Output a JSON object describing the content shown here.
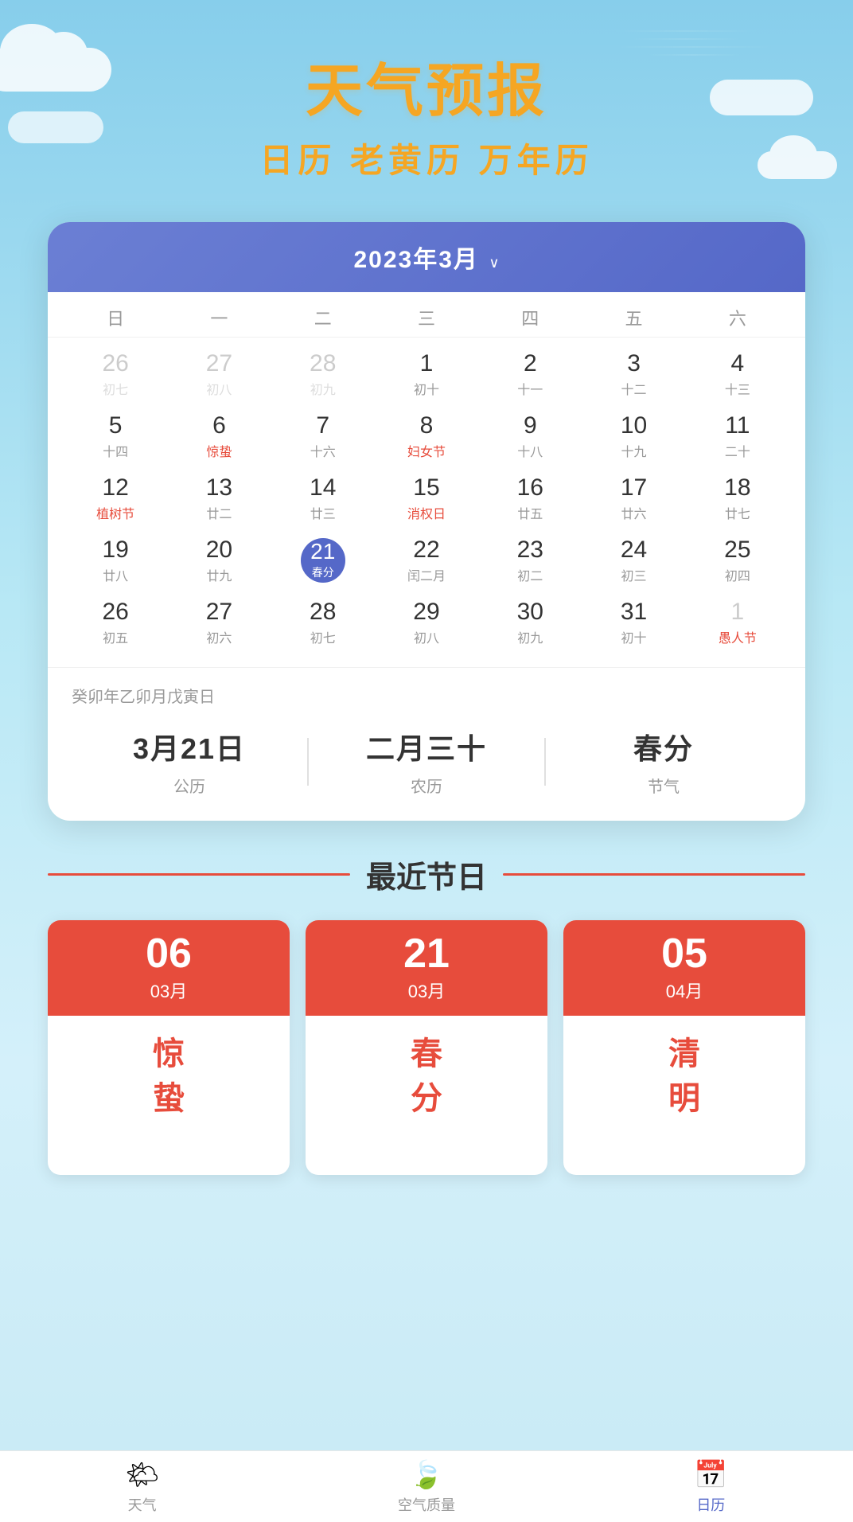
{
  "app": {
    "title": "天气预报",
    "subtitle": "日历 老黄历 万年历"
  },
  "calendar": {
    "month_title": "2023年3月",
    "chevron": "∨",
    "weekdays": [
      "日",
      "一",
      "二",
      "三",
      "四",
      "五",
      "六"
    ],
    "rows": [
      [
        {
          "date": "26",
          "lunar": "初七",
          "other": true
        },
        {
          "date": "27",
          "lunar": "初八",
          "other": true
        },
        {
          "date": "28",
          "lunar": "初九",
          "other": true
        },
        {
          "date": "1",
          "lunar": "初十"
        },
        {
          "date": "2",
          "lunar": "十一"
        },
        {
          "date": "3",
          "lunar": "十二"
        },
        {
          "date": "4",
          "lunar": "十三"
        }
      ],
      [
        {
          "date": "5",
          "lunar": "十四"
        },
        {
          "date": "6",
          "lunar": "惊蛰",
          "festival": true
        },
        {
          "date": "7",
          "lunar": "十六"
        },
        {
          "date": "8",
          "lunar": "妇女节",
          "festival": true
        },
        {
          "date": "9",
          "lunar": "十八"
        },
        {
          "date": "10",
          "lunar": "十九"
        },
        {
          "date": "11",
          "lunar": "二十"
        }
      ],
      [
        {
          "date": "12",
          "lunar": "植树节",
          "festival": true
        },
        {
          "date": "13",
          "lunar": "廿二"
        },
        {
          "date": "14",
          "lunar": "廿三"
        },
        {
          "date": "15",
          "lunar": "消权日",
          "festival": true
        },
        {
          "date": "16",
          "lunar": "廿五"
        },
        {
          "date": "17",
          "lunar": "廿六"
        },
        {
          "date": "18",
          "lunar": "廿七"
        }
      ],
      [
        {
          "date": "19",
          "lunar": "廿八"
        },
        {
          "date": "20",
          "lunar": "廿九"
        },
        {
          "date": "21",
          "lunar": "春分",
          "today": true,
          "festival": true
        },
        {
          "date": "22",
          "lunar": "闰二月"
        },
        {
          "date": "23",
          "lunar": "初二"
        },
        {
          "date": "24",
          "lunar": "初三"
        },
        {
          "date": "25",
          "lunar": "初四"
        }
      ],
      [
        {
          "date": "26",
          "lunar": "初五"
        },
        {
          "date": "27",
          "lunar": "初六"
        },
        {
          "date": "28",
          "lunar": "初七"
        },
        {
          "date": "29",
          "lunar": "初八"
        },
        {
          "date": "30",
          "lunar": "初九"
        },
        {
          "date": "31",
          "lunar": "初十"
        },
        {
          "date": "1",
          "lunar": "愚人节",
          "other": true,
          "festival": true
        }
      ]
    ],
    "detail": {
      "lunar_year": "癸卯年乙卯月戊寅日",
      "solar_date": "3月21日",
      "solar_label": "公历",
      "lunar_date": "二月三十",
      "lunar_label": "农历",
      "solar_term": "春分",
      "solar_term_label": "节气"
    }
  },
  "holidays": {
    "section_title": "最近节日",
    "items": [
      {
        "day": "06",
        "month": "03月",
        "name_chars": [
          "惊",
          "蛰"
        ]
      },
      {
        "day": "21",
        "month": "03月",
        "name_chars": [
          "春",
          "分"
        ]
      },
      {
        "day": "05",
        "month": "04月",
        "name_chars": [
          "清",
          "明"
        ]
      }
    ]
  },
  "bottom_nav": {
    "items": [
      {
        "label": "天气",
        "icon": "🌤",
        "active": false
      },
      {
        "label": "空气质量",
        "icon": "🍃",
        "active": false
      },
      {
        "label": "日历",
        "icon": "📅",
        "active": true
      }
    ]
  }
}
